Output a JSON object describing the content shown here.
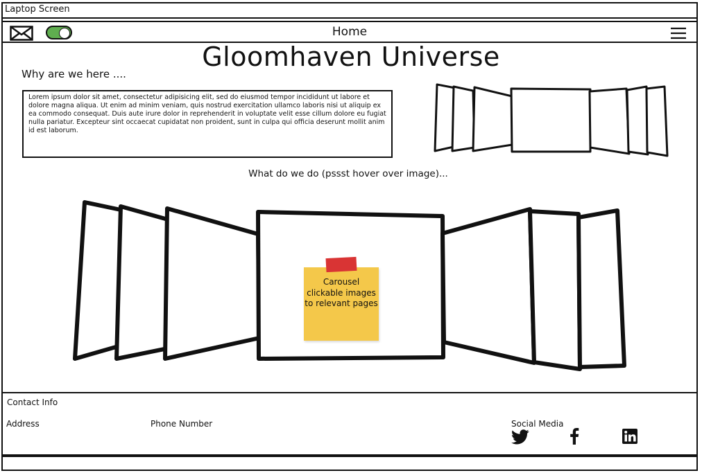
{
  "window": {
    "title": "Laptop Screen"
  },
  "nav": {
    "title": "Home",
    "mail_icon": "mail-icon",
    "toggle": "toggle-switch",
    "menu_icon": "hamburger-icon"
  },
  "hero": {
    "title": "Gloomhaven Universe"
  },
  "about": {
    "heading": "Why are we here ....",
    "body": "Lorem ipsum dolor sit amet, consectetur adipisicing elit, sed do eiusmod tempor incididunt ut labore et dolore magna aliqua. Ut enim ad minim veniam, quis nostrud exercitation ullamco laboris nisi ut aliquip ex ea commodo consequat. Duis aute irure dolor in reprehenderit in voluptate velit esse cillum dolore eu fugiat nulla pariatur. Excepteur sint occaecat cupidatat non proident, sunt in culpa qui officia deserunt mollit anim id est laborum."
  },
  "services": {
    "heading": "What do we do (pssst hover over image)...",
    "note": "Carousel clickable images to relevant pages",
    "note_color": "#f4c84a",
    "tape_color": "#d93434"
  },
  "footer": {
    "contact": "Contact Info",
    "address": "Address",
    "phone": "Phone Number",
    "social": "Social Media",
    "icons": [
      "twitter-icon",
      "facebook-icon",
      "linkedin-icon"
    ]
  },
  "colors": {
    "toggle_on": "#5fae4f"
  }
}
